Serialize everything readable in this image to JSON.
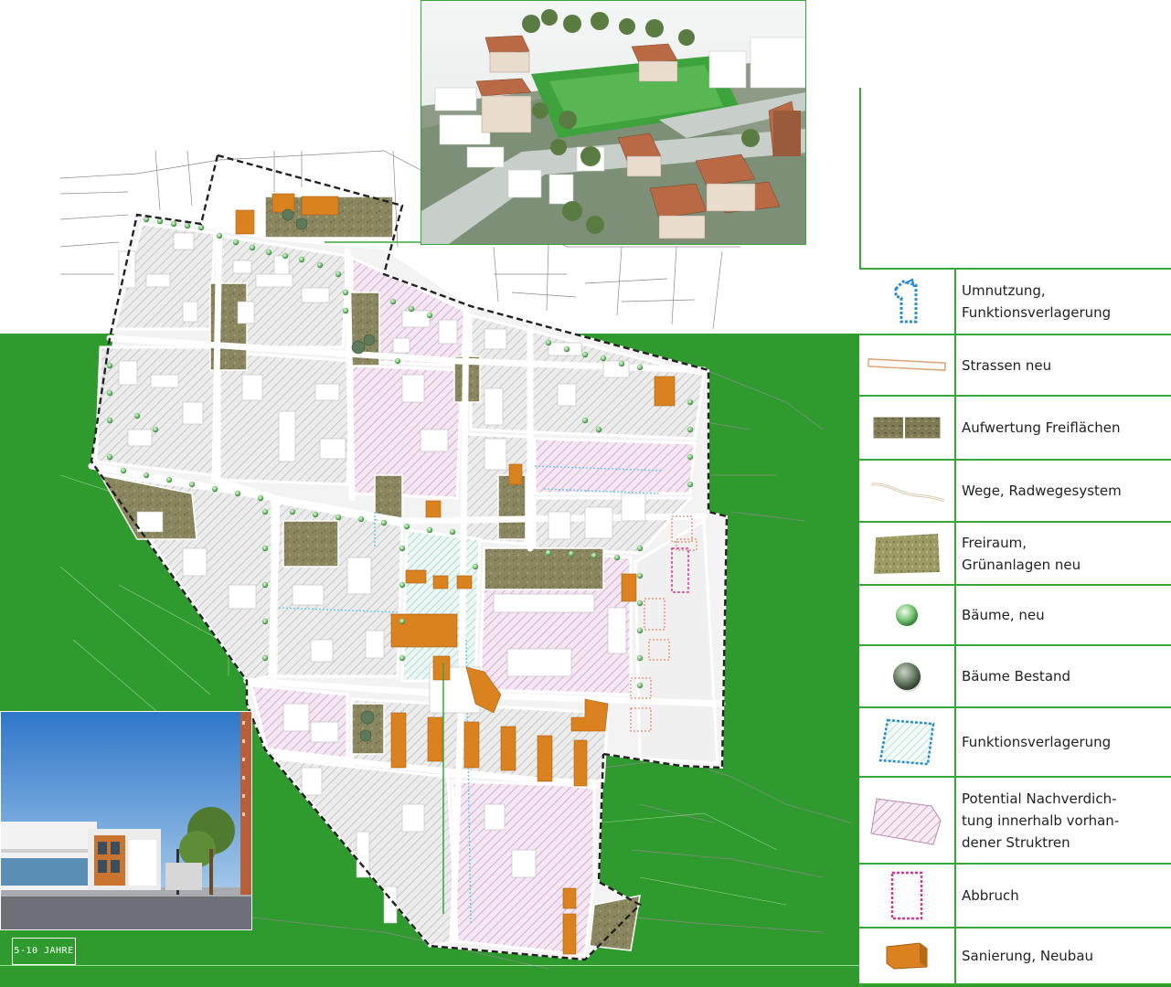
{
  "colors": {
    "accent_green": "#2f9a2d",
    "legend_border": "#3aa63a",
    "renovation_orange": "#d9821f",
    "demolition_magenta": "#e0338c",
    "relocation_blue": "#2a8bd1",
    "new_street": "#d9a57a",
    "open_space_olive": "#8a8660",
    "hatch_pink": "#d39bc8"
  },
  "timeline": {
    "label": "5-10 JAHRE"
  },
  "legend": {
    "items": [
      {
        "symbol": "building-relocation-icon",
        "label": "Umnutzung,\nFunktionsverlagerung"
      },
      {
        "symbol": "new-street-icon",
        "label": "Strassen neu"
      },
      {
        "symbol": "open-space-upgrade-icon",
        "label": "Aufwertung Freiflächen"
      },
      {
        "symbol": "path-cycle-icon",
        "label": "Wege, Radwegesystem"
      },
      {
        "symbol": "green-space-new-icon",
        "label": "Freiraum,\nGrünanlagen neu"
      },
      {
        "symbol": "tree-new-icon",
        "label": "Bäume, neu"
      },
      {
        "symbol": "tree-existing-icon",
        "label": "Bäume Bestand"
      },
      {
        "symbol": "function-relocation-icon",
        "label": "Funktionsverlagerung"
      },
      {
        "symbol": "densification-hatch-icon",
        "label": "Potential Nachverdich-\ntung innerhalb vorhan-\ndener Struktren"
      },
      {
        "symbol": "demolition-icon",
        "label": "Abbruch"
      },
      {
        "symbol": "renovation-building-icon",
        "label": "Sanierung, Neubau"
      }
    ]
  }
}
